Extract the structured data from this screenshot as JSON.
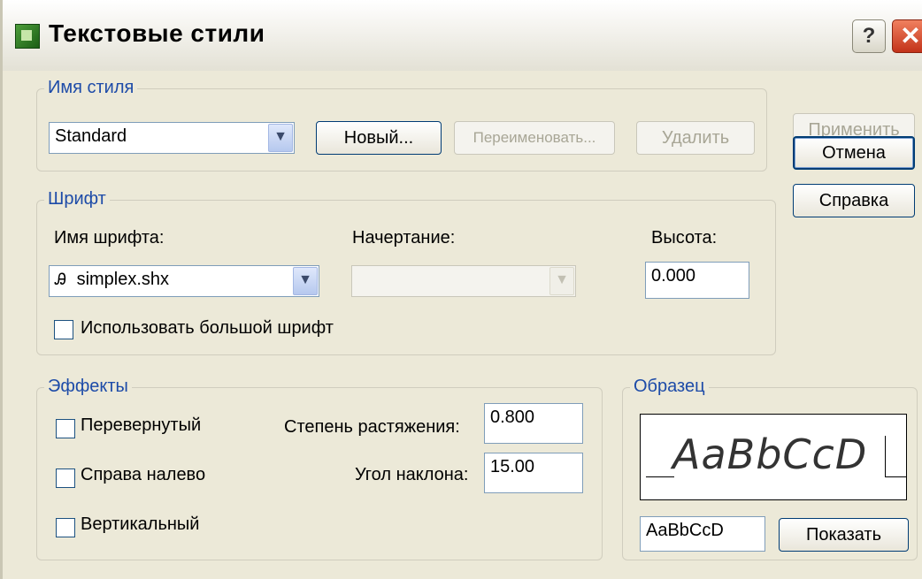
{
  "window": {
    "title": "Текстовые стили",
    "help_label": "?",
    "close_label": "✕"
  },
  "style_name": {
    "group_label": "Имя стиля",
    "selected": "Standard",
    "new_button": "Новый...",
    "rename_button": "Переименовать...",
    "delete_button": "Удалить"
  },
  "side_buttons": {
    "apply": "Применить",
    "cancel": "Отмена",
    "help": "Справка"
  },
  "font": {
    "group_label": "Шрифт",
    "font_name_label": "Имя шрифта:",
    "font_name_value": "simplex.shx",
    "font_icon": "shx-font-icon",
    "font_style_label": "Начертание:",
    "font_style_value": "",
    "height_label": "Высота:",
    "height_value": "0.000",
    "big_font_label": "Использовать большой шрифт",
    "big_font_checked": false
  },
  "effects": {
    "group_label": "Эффекты",
    "upside_down_label": "Перевернутый",
    "upside_down_checked": false,
    "backwards_label": "Справа налево",
    "backwards_checked": false,
    "vertical_label": "Вертикальный",
    "vertical_checked": false,
    "width_factor_label": "Степень растяжения:",
    "width_factor_value": "0.800",
    "oblique_label": "Угол наклона:",
    "oblique_value": "15.00"
  },
  "sample": {
    "group_label": "Образец",
    "preview_text": "AaBbCcD",
    "input_value": "AaBbCcD",
    "show_button": "Показать"
  },
  "colors": {
    "dialog_bg": "#ece9d8",
    "legend_text": "#1d4ba8",
    "focus_border": "#003c74"
  }
}
